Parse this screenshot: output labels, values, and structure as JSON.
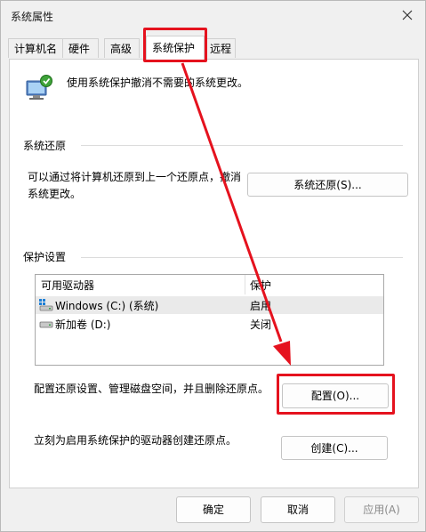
{
  "window": {
    "title": "系统属性"
  },
  "tabs": [
    {
      "label": "计算机名"
    },
    {
      "label": "硬件"
    },
    {
      "label": "高级"
    },
    {
      "label": "系统保护",
      "active": true
    },
    {
      "label": "远程"
    }
  ],
  "intro": {
    "text": "使用系统保护撤消不需要的系统更改。"
  },
  "restore": {
    "group_title": "系统还原",
    "description_line1": "可以通过将计算机还原到上一个还原点，撤消",
    "description_line2": "系统更改。",
    "button_label": "系统还原(S)..."
  },
  "protection": {
    "group_title": "保护设置",
    "columns": {
      "drive": "可用驱动器",
      "protection": "保护"
    },
    "rows": [
      {
        "drive": "Windows (C:) (系统)",
        "status": "启用",
        "icon": "system-drive-icon"
      },
      {
        "drive": "新加卷 (D:)",
        "status": "关闭",
        "icon": "drive-icon"
      }
    ],
    "configure_text": "配置还原设置、管理磁盘空间，并且删除还原点。",
    "configure_button": "配置(O)...",
    "create_text": "立刻为启用系统保护的驱动器创建还原点。",
    "create_button": "创建(C)..."
  },
  "footer": {
    "ok": "确定",
    "cancel": "取消",
    "apply": "应用(A)"
  },
  "annotation_color": "#e5121e"
}
